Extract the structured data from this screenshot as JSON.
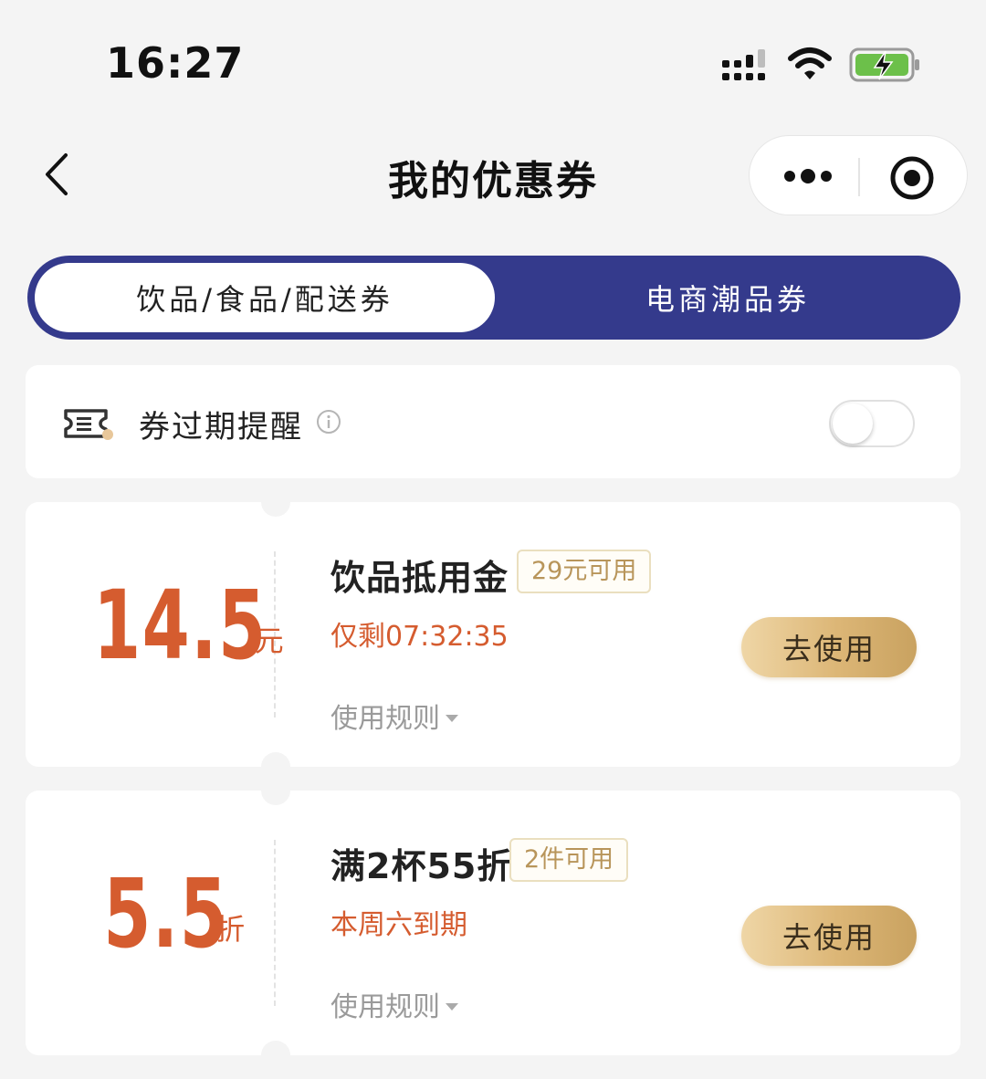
{
  "status_bar": {
    "time": "16:27"
  },
  "nav": {
    "title": "我的优惠券"
  },
  "tabs": [
    {
      "label": "饮品/食品/配送券",
      "active": true
    },
    {
      "label": "电商潮品券",
      "active": false
    }
  ],
  "reminder": {
    "label": "券过期提醒",
    "enabled": false
  },
  "coupons": [
    {
      "amount": "14.5",
      "unit": "元",
      "title": "饮品抵用金",
      "tag": "29元可用",
      "deadline": "仅剩07:32:35",
      "rules_label": "使用规则",
      "button_label": "去使用"
    },
    {
      "amount": "5.5",
      "unit": "折",
      "title": "满2杯55折",
      "tag": "2件可用",
      "deadline": "本周六到期",
      "rules_label": "使用规则",
      "button_label": "去使用"
    }
  ],
  "colors": {
    "accent_navy": "#343a8c",
    "price_orange": "#d55c2f",
    "gold_button": "#dcb676",
    "tag_gold": "#b8955a",
    "battery_green": "#6cc04a"
  },
  "icons": [
    "back-icon",
    "more-icon",
    "target-icon",
    "ticket-icon",
    "info-icon",
    "signal-icon",
    "wifi-icon",
    "battery-icon"
  ]
}
